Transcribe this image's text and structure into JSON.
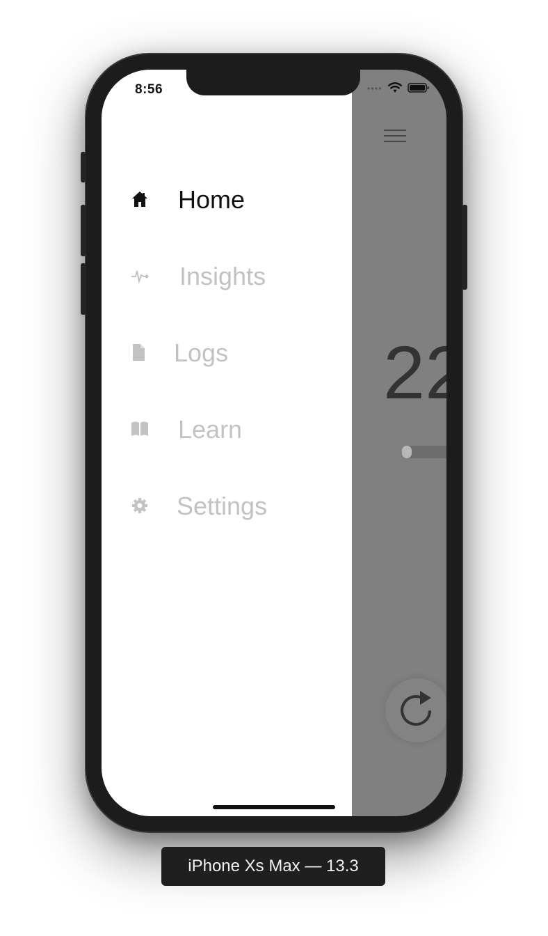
{
  "status_bar": {
    "time": "8:56"
  },
  "drawer": {
    "items": [
      {
        "label": "Home",
        "icon": "home-icon",
        "active": true
      },
      {
        "label": "Insights",
        "icon": "pulse-icon",
        "active": false
      },
      {
        "label": "Logs",
        "icon": "document-icon",
        "active": false
      },
      {
        "label": "Learn",
        "icon": "book-icon",
        "active": false
      },
      {
        "label": "Settings",
        "icon": "gear-icon",
        "active": false
      }
    ]
  },
  "main": {
    "counter_text": "22",
    "slider_value": 0.0
  },
  "simulator": {
    "device_label": "iPhone Xs Max — 13.3"
  },
  "colors": {
    "active_text": "#111111",
    "inactive_text": "#c2c2c2",
    "overlay": "#808080",
    "device_frame": "#1c1c1c"
  }
}
